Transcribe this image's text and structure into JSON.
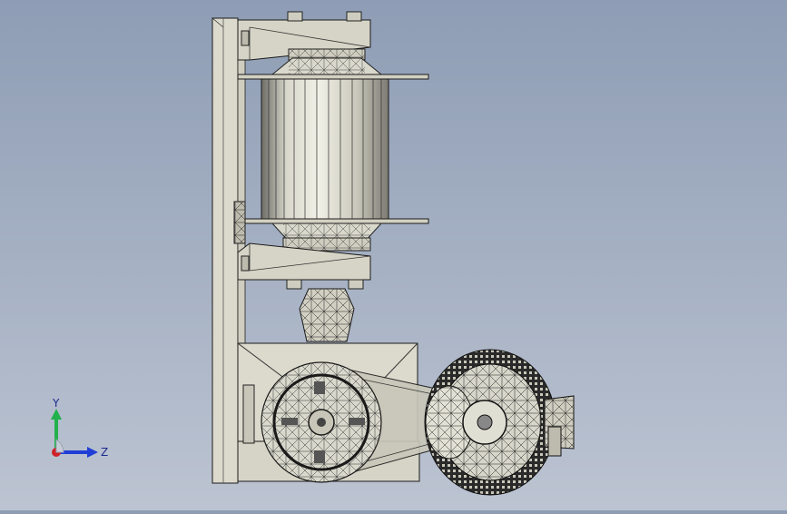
{
  "viewport": {
    "background_top": "#8e9db5",
    "background_bottom": "#bcc4d2",
    "model_fill": "#d8d6c8",
    "model_edge": "#1a1a1a"
  },
  "triad": {
    "y_label": "Y",
    "z_label": "Z",
    "y_color": "#22b14c",
    "z_color": "#1f3fd6",
    "x_color": "#d0202a"
  }
}
